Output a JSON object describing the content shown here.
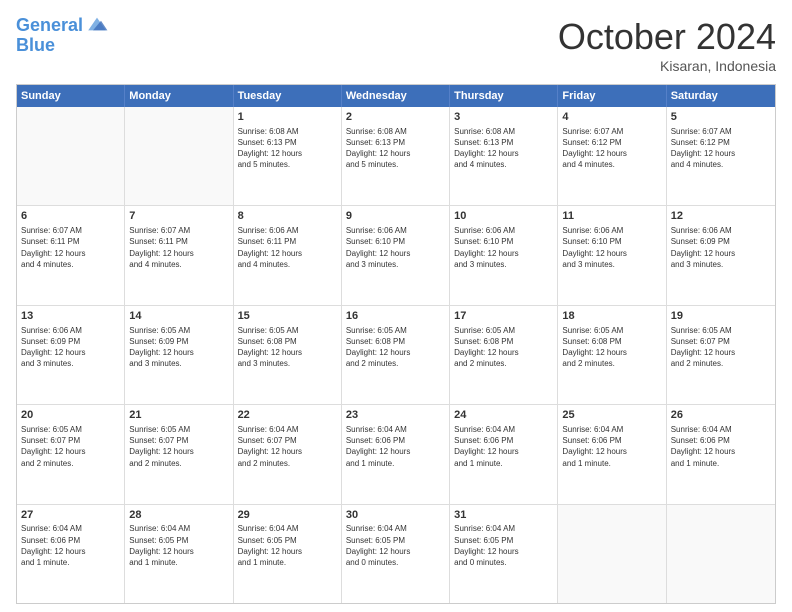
{
  "header": {
    "logo_line1": "General",
    "logo_line2": "Blue",
    "month": "October 2024",
    "location": "Kisaran, Indonesia"
  },
  "days_of_week": [
    "Sunday",
    "Monday",
    "Tuesday",
    "Wednesday",
    "Thursday",
    "Friday",
    "Saturday"
  ],
  "weeks": [
    [
      {
        "day": "",
        "info": ""
      },
      {
        "day": "",
        "info": ""
      },
      {
        "day": "1",
        "info": "Sunrise: 6:08 AM\nSunset: 6:13 PM\nDaylight: 12 hours\nand 5 minutes."
      },
      {
        "day": "2",
        "info": "Sunrise: 6:08 AM\nSunset: 6:13 PM\nDaylight: 12 hours\nand 5 minutes."
      },
      {
        "day": "3",
        "info": "Sunrise: 6:08 AM\nSunset: 6:13 PM\nDaylight: 12 hours\nand 4 minutes."
      },
      {
        "day": "4",
        "info": "Sunrise: 6:07 AM\nSunset: 6:12 PM\nDaylight: 12 hours\nand 4 minutes."
      },
      {
        "day": "5",
        "info": "Sunrise: 6:07 AM\nSunset: 6:12 PM\nDaylight: 12 hours\nand 4 minutes."
      }
    ],
    [
      {
        "day": "6",
        "info": "Sunrise: 6:07 AM\nSunset: 6:11 PM\nDaylight: 12 hours\nand 4 minutes."
      },
      {
        "day": "7",
        "info": "Sunrise: 6:07 AM\nSunset: 6:11 PM\nDaylight: 12 hours\nand 4 minutes."
      },
      {
        "day": "8",
        "info": "Sunrise: 6:06 AM\nSunset: 6:11 PM\nDaylight: 12 hours\nand 4 minutes."
      },
      {
        "day": "9",
        "info": "Sunrise: 6:06 AM\nSunset: 6:10 PM\nDaylight: 12 hours\nand 3 minutes."
      },
      {
        "day": "10",
        "info": "Sunrise: 6:06 AM\nSunset: 6:10 PM\nDaylight: 12 hours\nand 3 minutes."
      },
      {
        "day": "11",
        "info": "Sunrise: 6:06 AM\nSunset: 6:10 PM\nDaylight: 12 hours\nand 3 minutes."
      },
      {
        "day": "12",
        "info": "Sunrise: 6:06 AM\nSunset: 6:09 PM\nDaylight: 12 hours\nand 3 minutes."
      }
    ],
    [
      {
        "day": "13",
        "info": "Sunrise: 6:06 AM\nSunset: 6:09 PM\nDaylight: 12 hours\nand 3 minutes."
      },
      {
        "day": "14",
        "info": "Sunrise: 6:05 AM\nSunset: 6:09 PM\nDaylight: 12 hours\nand 3 minutes."
      },
      {
        "day": "15",
        "info": "Sunrise: 6:05 AM\nSunset: 6:08 PM\nDaylight: 12 hours\nand 3 minutes."
      },
      {
        "day": "16",
        "info": "Sunrise: 6:05 AM\nSunset: 6:08 PM\nDaylight: 12 hours\nand 2 minutes."
      },
      {
        "day": "17",
        "info": "Sunrise: 6:05 AM\nSunset: 6:08 PM\nDaylight: 12 hours\nand 2 minutes."
      },
      {
        "day": "18",
        "info": "Sunrise: 6:05 AM\nSunset: 6:08 PM\nDaylight: 12 hours\nand 2 minutes."
      },
      {
        "day": "19",
        "info": "Sunrise: 6:05 AM\nSunset: 6:07 PM\nDaylight: 12 hours\nand 2 minutes."
      }
    ],
    [
      {
        "day": "20",
        "info": "Sunrise: 6:05 AM\nSunset: 6:07 PM\nDaylight: 12 hours\nand 2 minutes."
      },
      {
        "day": "21",
        "info": "Sunrise: 6:05 AM\nSunset: 6:07 PM\nDaylight: 12 hours\nand 2 minutes."
      },
      {
        "day": "22",
        "info": "Sunrise: 6:04 AM\nSunset: 6:07 PM\nDaylight: 12 hours\nand 2 minutes."
      },
      {
        "day": "23",
        "info": "Sunrise: 6:04 AM\nSunset: 6:06 PM\nDaylight: 12 hours\nand 1 minute."
      },
      {
        "day": "24",
        "info": "Sunrise: 6:04 AM\nSunset: 6:06 PM\nDaylight: 12 hours\nand 1 minute."
      },
      {
        "day": "25",
        "info": "Sunrise: 6:04 AM\nSunset: 6:06 PM\nDaylight: 12 hours\nand 1 minute."
      },
      {
        "day": "26",
        "info": "Sunrise: 6:04 AM\nSunset: 6:06 PM\nDaylight: 12 hours\nand 1 minute."
      }
    ],
    [
      {
        "day": "27",
        "info": "Sunrise: 6:04 AM\nSunset: 6:06 PM\nDaylight: 12 hours\nand 1 minute."
      },
      {
        "day": "28",
        "info": "Sunrise: 6:04 AM\nSunset: 6:05 PM\nDaylight: 12 hours\nand 1 minute."
      },
      {
        "day": "29",
        "info": "Sunrise: 6:04 AM\nSunset: 6:05 PM\nDaylight: 12 hours\nand 1 minute."
      },
      {
        "day": "30",
        "info": "Sunrise: 6:04 AM\nSunset: 6:05 PM\nDaylight: 12 hours\nand 0 minutes."
      },
      {
        "day": "31",
        "info": "Sunrise: 6:04 AM\nSunset: 6:05 PM\nDaylight: 12 hours\nand 0 minutes."
      },
      {
        "day": "",
        "info": ""
      },
      {
        "day": "",
        "info": ""
      }
    ]
  ]
}
